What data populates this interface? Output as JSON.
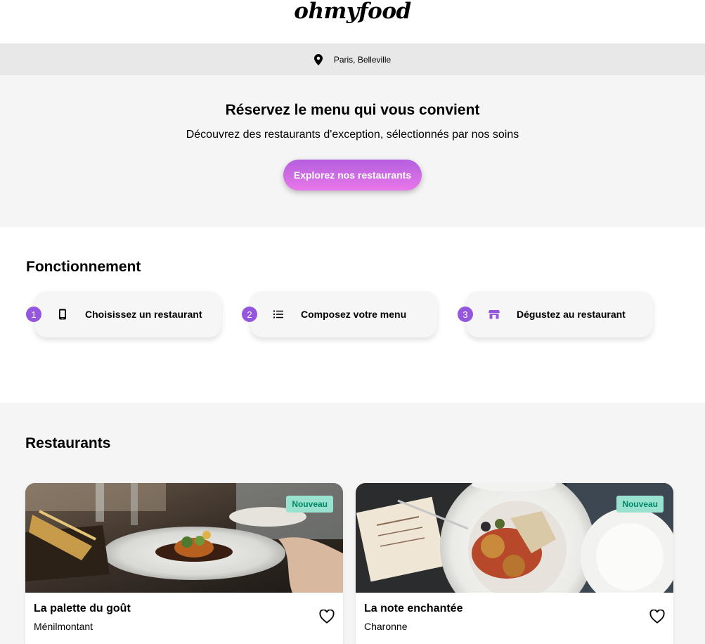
{
  "header": {
    "logo": "ohmyfood"
  },
  "location": {
    "text": "Paris, Belleville",
    "icon": "location-pin-icon"
  },
  "hero": {
    "title": "Réservez le menu qui vous convient",
    "subtitle": "Découvrez des restaurants d'exception, sélectionnés par nos soins",
    "cta_label": "Explorez nos restaurants"
  },
  "features": {
    "title": "Fonctionnement",
    "steps": [
      {
        "number": "1",
        "label": "Choisissez un restaurant",
        "icon": "phone-icon"
      },
      {
        "number": "2",
        "label": "Composez votre menu",
        "icon": "list-icon"
      },
      {
        "number": "3",
        "label": "Dégustez au restaurant",
        "icon": "store-icon"
      }
    ]
  },
  "restaurants": {
    "title": "Restaurants",
    "items": [
      {
        "name": "La palette du goût",
        "location": "Ménilmontant",
        "badge": "Nouveau"
      },
      {
        "name": "La note enchantée",
        "location": "Charonne",
        "badge": "Nouveau"
      }
    ]
  },
  "colors": {
    "accent": "#9356dc",
    "badge_bg": "#99e2d0",
    "badge_text": "#008766"
  }
}
